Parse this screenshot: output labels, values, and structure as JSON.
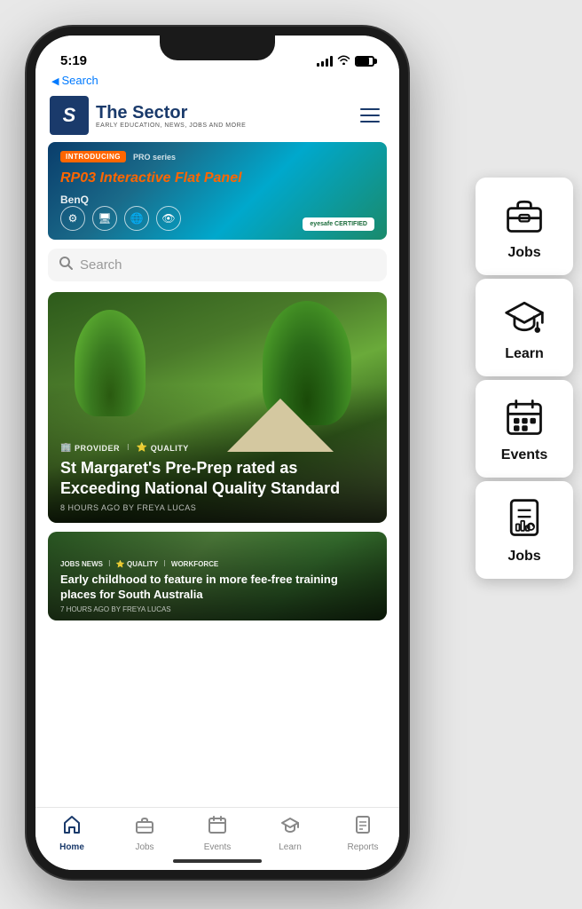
{
  "phone": {
    "status": {
      "time": "5:19",
      "back_nav": "Search"
    }
  },
  "header": {
    "logo_letter": "S",
    "logo_title": "The Sector",
    "logo_subtitle": "EARLY EDUCATION, NEWS, JOBS AND MORE",
    "hamburger_label": "Menu"
  },
  "banner": {
    "badge": "INTRODUCING",
    "series": "PRO series",
    "model": "RP03",
    "description": "Interactive Flat Panel",
    "brand": "BenQ",
    "partner": "eyesafe CERTIFIED"
  },
  "search": {
    "placeholder": "Search"
  },
  "articles": [
    {
      "tags": [
        "PROVIDER",
        "QUALITY"
      ],
      "title": "St Margaret's Pre-Prep rated as Exceeding National Quality Standard",
      "time_ago": "8 HOURS AGO",
      "by": "BY FREYA LUCAS"
    },
    {
      "tags": [
        "JOBS NEWS",
        "QUALITY",
        "WORKFORCE"
      ],
      "title": "Early childhood to feature in more fee-free training places for South Australia",
      "time_ago": "7 HOURS AGO",
      "by": "BY FREYA LUCAS"
    }
  ],
  "bottom_nav": {
    "items": [
      {
        "label": "Home",
        "icon": "home",
        "active": true
      },
      {
        "label": "Jobs",
        "icon": "briefcase",
        "active": false
      },
      {
        "label": "Events",
        "icon": "calendar",
        "active": false
      },
      {
        "label": "Learn",
        "icon": "graduation",
        "active": false
      },
      {
        "label": "Reports",
        "icon": "document",
        "active": false
      }
    ]
  },
  "floating_buttons": [
    {
      "label": "Jobs",
      "icon": "briefcase"
    },
    {
      "label": "Learn",
      "icon": "graduation"
    },
    {
      "label": "Events",
      "icon": "calendar"
    },
    {
      "label": "Jobs",
      "icon": "document"
    }
  ]
}
